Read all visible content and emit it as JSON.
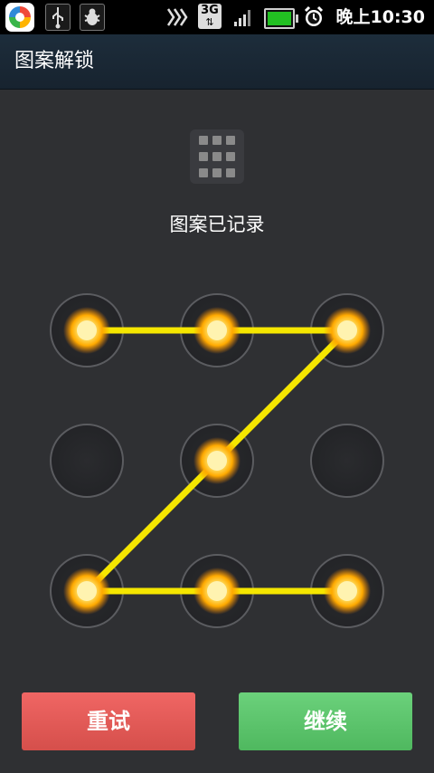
{
  "status_bar": {
    "time": "晚上10:30",
    "network": "3G"
  },
  "header": {
    "title": "图案解锁"
  },
  "main": {
    "status": "图案已记录",
    "pattern_path": [
      0,
      1,
      2,
      4,
      6,
      7,
      8
    ]
  },
  "actions": {
    "retry_label": "重试",
    "continue_label": "继续"
  },
  "colors": {
    "line": "#f5e600",
    "dot_glow": "#ffb000",
    "retry": "#e05a57",
    "continue": "#5cc56c"
  }
}
